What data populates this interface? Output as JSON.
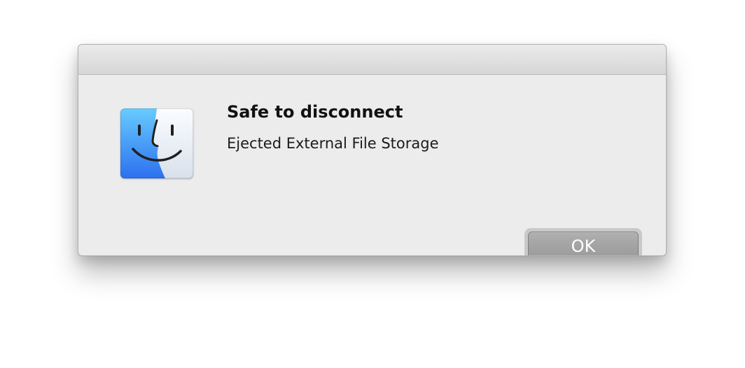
{
  "dialog": {
    "title": "Safe to disconnect",
    "message": "Ejected External File Storage",
    "button_label": "OK",
    "icon_name": "finder-icon"
  },
  "colors": {
    "dialog_background": "#ececec",
    "button_fill": "#a8a8a8",
    "button_ring": "#c9c9c9",
    "icon_blue": "#2f7ef0",
    "icon_light": "#e8edf4"
  }
}
